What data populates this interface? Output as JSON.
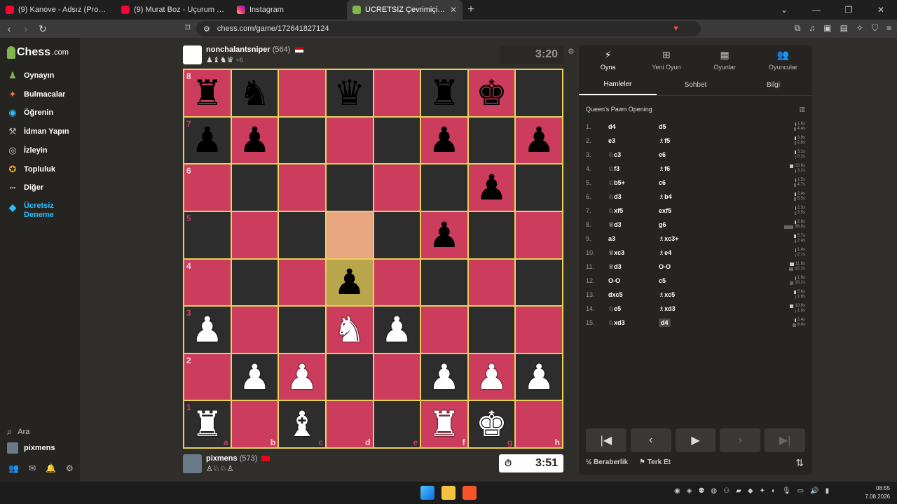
{
  "browser": {
    "tabs": [
      {
        "title": "(9) Kanove - Adsız (Prod.Kanove) - Yo",
        "icon": "youtube",
        "active": false
      },
      {
        "title": "(9) Murat Boz - Uçurum - YouTube",
        "icon": "youtube",
        "active": false
      },
      {
        "title": "Instagram",
        "icon": "instagram",
        "active": false
      },
      {
        "title": "ÜCRETSİZ Çevrimiçi Satranç O",
        "icon": "chess",
        "active": true
      }
    ],
    "url": "chess.com/game/172641827124"
  },
  "sidebar": {
    "logo": "Chess",
    "logo_suffix": ".com",
    "items": [
      {
        "label": "Oynayın",
        "color": "#81b64c"
      },
      {
        "label": "Bulmacalar",
        "color": "#f07b3f"
      },
      {
        "label": "Öğrenin",
        "color": "#27c1ff"
      },
      {
        "label": "İdman Yapın",
        "color": "#b0b0b0"
      },
      {
        "label": "İzleyin",
        "color": "#c0c0c0"
      },
      {
        "label": "Topluluk",
        "color": "#f5a623"
      },
      {
        "label": "Diğer",
        "color": "#bbbbbb"
      }
    ],
    "trial": "Ücretsiz Deneme",
    "search": "Ara",
    "user": "pixmens"
  },
  "top_player": {
    "name": "nonchalantsniper",
    "rating": "(564)",
    "captured": "♟♝♞♛",
    "advantage": "+6",
    "clock": "3:20"
  },
  "bottom_player": {
    "name": "pixmens",
    "rating": "(573)",
    "captured": "♙♘♘♙",
    "clock": "3:51"
  },
  "board": {
    "files": [
      "a",
      "b",
      "c",
      "d",
      "e",
      "f",
      "g",
      "h"
    ],
    "ranks": [
      "8",
      "7",
      "6",
      "5",
      "4",
      "3",
      "2",
      "1"
    ],
    "highlight": [
      "d5",
      "d4"
    ],
    "pieces": {
      "a8": "bR",
      "b8": "bN",
      "d8": "bQ",
      "f8": "bR",
      "g8": "bK",
      "a7": "bP",
      "b7": "bP",
      "f7": "bP",
      "h7": "bP",
      "g6": "bP",
      "f5": "bP",
      "d4": "bP",
      "a3": "wP",
      "d3": "wN",
      "e3": "wP",
      "b2": "wP",
      "c2": "wP",
      "f2": "wP",
      "g2": "wP",
      "h2": "wP",
      "a1": "wR",
      "c1": "wB",
      "f1": "wR",
      "g1": "wK"
    }
  },
  "panel": {
    "tabs": [
      {
        "label": "Oyna",
        "icon": "⚡"
      },
      {
        "label": "Yeni Oyun",
        "icon": "⊞"
      },
      {
        "label": "Oyunlar",
        "icon": "▦"
      },
      {
        "label": "Oyuncular",
        "icon": "👥"
      }
    ],
    "subtabs": [
      "Hamleler",
      "Sohbet",
      "Bilgi"
    ],
    "opening": "Queen's Pawn Opening",
    "moves": [
      {
        "n": "1.",
        "w": "d4",
        "b": "d5",
        "tw": "1.6s",
        "tb": "4.4s"
      },
      {
        "n": "2.",
        "w": "e3",
        "b": "♗f5",
        "tw": "3.9s",
        "tb": "2.8s"
      },
      {
        "n": "3.",
        "w": "♘c3",
        "b": "e6",
        "tw": "3.1s",
        "tb": "0.2s"
      },
      {
        "n": "4.",
        "w": "♘f3",
        "b": "♗f6",
        "tw": "10.6s",
        "tb": "3.2s"
      },
      {
        "n": "5.",
        "w": "♘b5+",
        "b": "c6",
        "tw": "1.5s",
        "tb": "4.7s"
      },
      {
        "n": "6.",
        "w": "♘d3",
        "b": "♗b4",
        "tw": "2.4s",
        "tb": "5.5s"
      },
      {
        "n": "7.",
        "w": "♘xf5",
        "b": "exf5",
        "tw": "2.3s",
        "tb": "3.5s"
      },
      {
        "n": "8.",
        "w": "♕d3",
        "b": "g6",
        "tw": "2.8s",
        "tb": "36.0s"
      },
      {
        "n": "9.",
        "w": "a3",
        "b": "♗xc3+",
        "tw": "5.7s",
        "tb": "2.4s"
      },
      {
        "n": "10.",
        "w": "♕xc3",
        "b": "♗e4",
        "tw": "1.4s",
        "tb": "2.1s"
      },
      {
        "n": "11.",
        "w": "♕d3",
        "b": "O-O",
        "tw": "11.8s",
        "tb": "12.2s"
      },
      {
        "n": "12.",
        "w": "O-O",
        "b": "c5",
        "tw": "1.9s",
        "tb": "10.2s"
      },
      {
        "n": "13.",
        "w": "dxc5",
        "b": "♗xc5",
        "tw": "5.6s",
        "tb": "1.8s"
      },
      {
        "n": "14.",
        "w": "♘e5",
        "b": "♗xd3",
        "tw": "10.8s",
        "tb": "1.8s"
      },
      {
        "n": "15.",
        "w": "♘xd3",
        "b": "d4",
        "tw": "2.4s",
        "tb": "8.4s"
      }
    ],
    "draw_label": "Beraberlik",
    "draw_icon": "½",
    "resign_label": "Terk Et"
  },
  "taskbar": {
    "time": "08:55",
    "date": "7.08.2026"
  }
}
